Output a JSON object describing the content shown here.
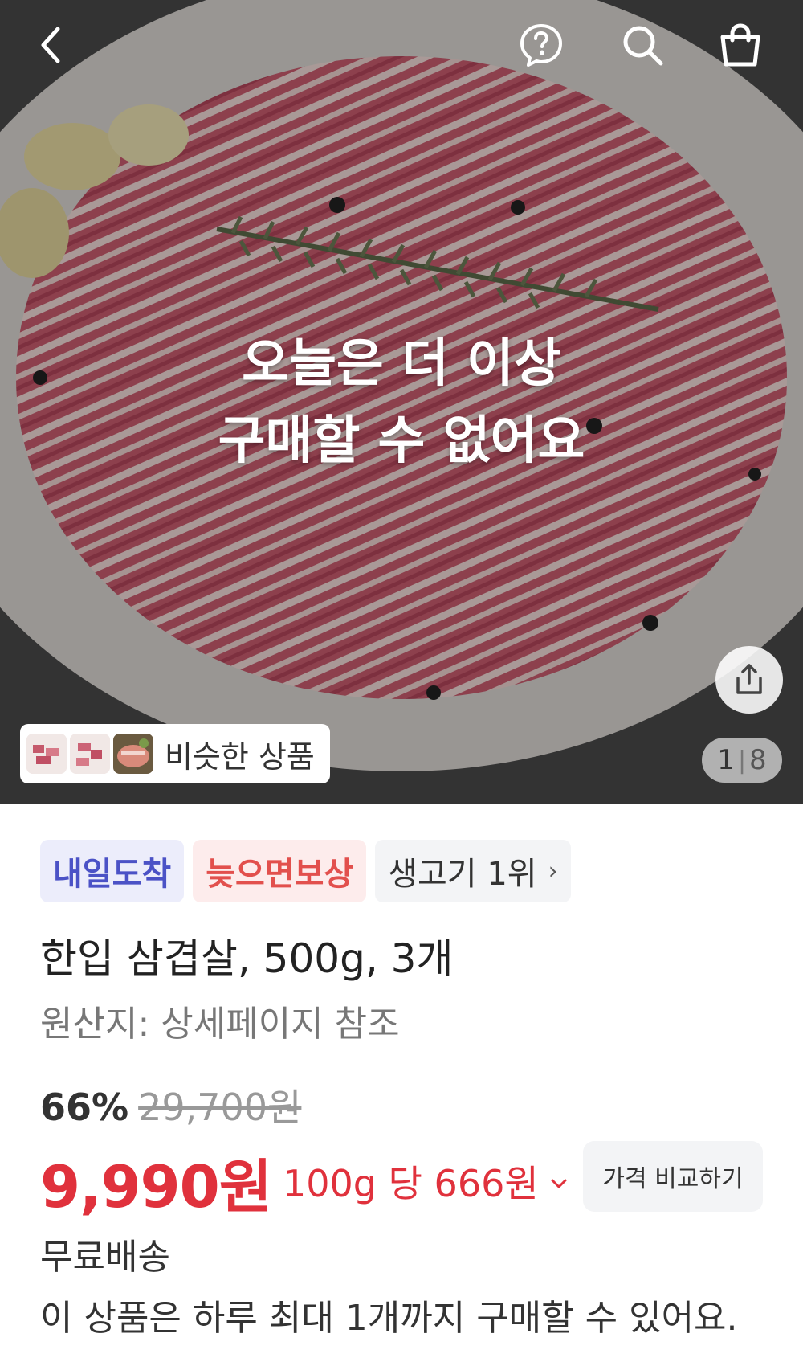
{
  "hero": {
    "overlay_line1": "오늘은 더 이상",
    "overlay_line2": "구매할 수 없어요",
    "similar_label": "비슷한 상품",
    "page_current": "1",
    "page_total": "8",
    "icons": [
      "back-arrow-icon",
      "help-question-icon",
      "search-icon",
      "shopping-bag-icon",
      "share-icon"
    ]
  },
  "badges": {
    "delivery": "내일도착",
    "late_compensation": "늦으면보상",
    "ranking": "생고기 1위"
  },
  "product": {
    "title": "한입 삼겹살, 500g, 3개",
    "origin": "원산지: 상세페이지 참조"
  },
  "price": {
    "discount": "66%",
    "original": "29,700원",
    "sale": "9,990원",
    "unit_price": "100g 당 666원",
    "compare_label": "가격 비교하기"
  },
  "shipping": {
    "label": "무료배송",
    "purchase_limit": "이 상품은 하루 최대 1개까지 구매할 수 있어요."
  },
  "colors": {
    "price_red": "#e0313c",
    "badge_blue": "#4b52c6",
    "badge_red": "#e2504d"
  }
}
